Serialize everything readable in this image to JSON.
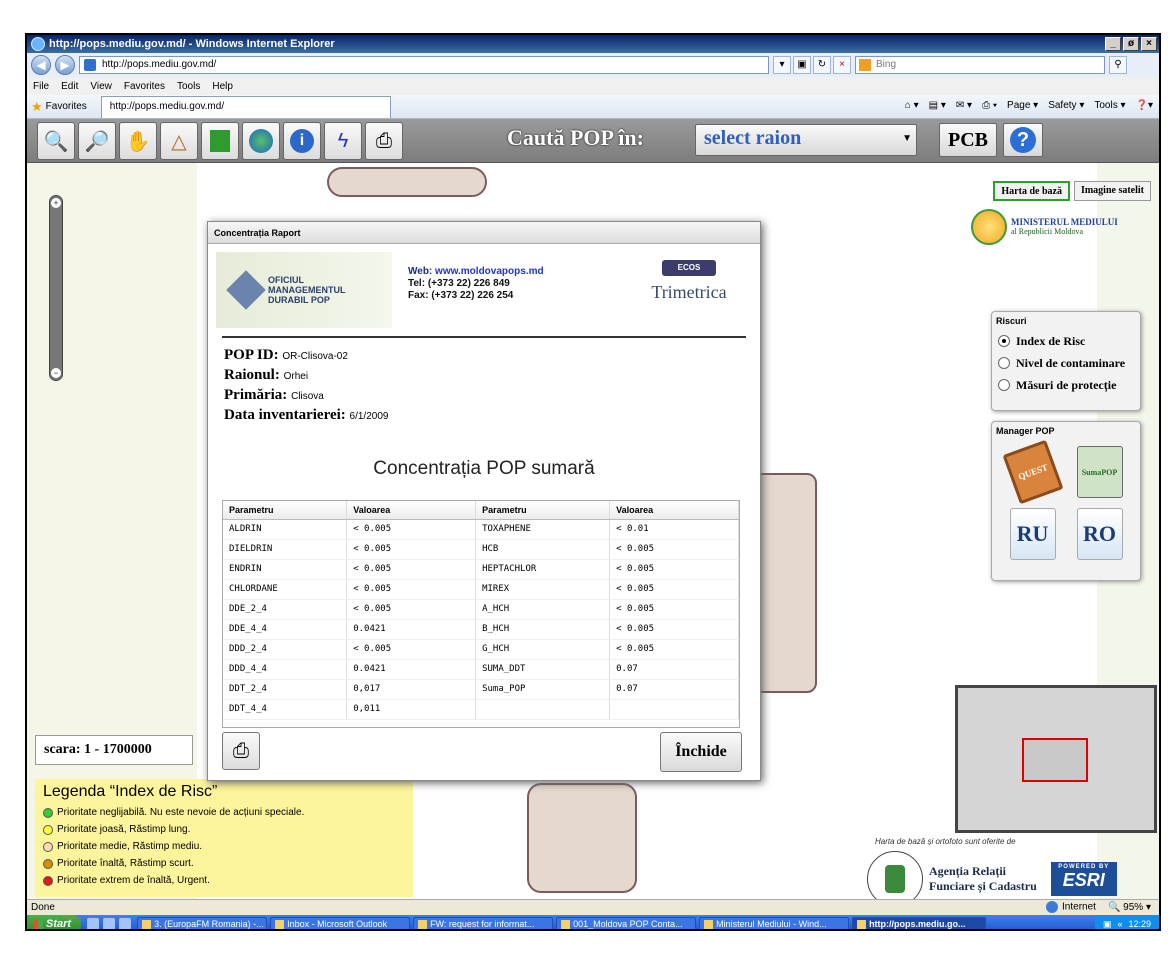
{
  "window": {
    "title": "http://pops.mediu.gov.md/ - Windows Internet Explorer",
    "address": "http://pops.mediu.gov.md/",
    "search_placeholder": "Bing",
    "controls": {
      "minimize": "_",
      "maximize": "ø",
      "close": "×"
    }
  },
  "menu": [
    "File",
    "Edit",
    "View",
    "Favorites",
    "Tools",
    "Help"
  ],
  "favbar": {
    "favorites_label": "Favorites",
    "tab_title": "http://pops.mediu.gov.md/",
    "commands": [
      "Page ▾",
      "Safety ▾",
      "Tools ▾"
    ]
  },
  "toolbar": {
    "search_label": "Caută POP în:",
    "raion_select": "select raion",
    "pcb_label": "PCB",
    "help_label": "?"
  },
  "map": {
    "scale_label": "scara: 1 - 1700000",
    "basemap_buttons": [
      "Harta de bază",
      "Imagine satelit"
    ],
    "ministry_name": "MINISTERUL MEDIULUI",
    "ministry_sub": "al Republicii Moldova",
    "credit": "Harta de bază și ortofoto sunt oferite de",
    "agency_line1": "Agenția Relații",
    "agency_line2": "Funciare și Cadastru",
    "esri_powered": "POWERED BY",
    "esri_logo": "ESRI"
  },
  "legend": {
    "title": "Legenda “Index de Risc”",
    "items": [
      {
        "color": "#33cc33",
        "label": "Prioritate neglijabilă. Nu este nevoie de acțiuni speciale."
      },
      {
        "color": "#ffff33",
        "label": "Prioritate joasă, Răstimp lung."
      },
      {
        "color": "#ffd9b3",
        "label": "Prioritate medie, Răstimp mediu."
      },
      {
        "color": "#d98c00",
        "label": "Prioritate înaltă, Răstimp scurt."
      },
      {
        "color": "#e31a1c",
        "label": "Prioritate extrem de înaltă, Urgent."
      }
    ]
  },
  "riscuri": {
    "title": "Riscuri",
    "options": [
      "Index de Risc",
      "Nivel de contaminare",
      "Măsuri de protecție"
    ],
    "selected": 0
  },
  "manager": {
    "title": "Manager POP",
    "quest": "QUEST",
    "suma": "SumaPOP",
    "ru": "RU",
    "ro": "RO"
  },
  "modal": {
    "title": "Concentrația Raport",
    "org": {
      "line1": "OFICIUL",
      "line2": "MANAGEMENTUL",
      "line3": "DURABIL POP"
    },
    "web_label": "Web:",
    "web": "www.moldovapops.md",
    "tel": "Tel:  (+373 22) 226 849",
    "fax": "Fax: (+373 22) 226 254",
    "ecos": "ECOS",
    "trimetrica": "Trimetrica",
    "pop_id_label": "POP ID:",
    "pop_id": "OR-Clisova-02",
    "raion_label": "Raionul:",
    "raion": "Orhei",
    "primaria_label": "Primăria:",
    "primaria": "Clisova",
    "data_label": "Data inventarierei:",
    "data": "6/1/2009",
    "summary_title": "Concentrația POP sumară",
    "headers": [
      "Parametru",
      "Valoarea",
      "Parametru",
      "Valoarea"
    ],
    "rows": [
      [
        "ALDRIN",
        "< 0.005",
        "TOXAPHENE",
        "< 0.01"
      ],
      [
        "DIELDRIN",
        "< 0.005",
        "HCB",
        "< 0.005"
      ],
      [
        "ENDRIN",
        "< 0.005",
        "HEPTACHLOR",
        "< 0.005"
      ],
      [
        "CHLORDANE",
        "< 0.005",
        "MIREX",
        "< 0.005"
      ],
      [
        "DDE_2_4",
        "< 0.005",
        "A_HCH",
        "< 0.005"
      ],
      [
        "DDE_4_4",
        "0.0421",
        "B_HCH",
        "< 0.005"
      ],
      [
        "DDD_2_4",
        "< 0.005",
        "G_HCH",
        "< 0.005"
      ],
      [
        "DDD_4_4",
        "0.0421",
        "SUMA_DDT",
        "0.07"
      ],
      [
        "DDT_2_4",
        "0,017",
        "Suma_POP",
        "0.07"
      ],
      [
        "DDT_4_4",
        "0,011",
        "",
        ""
      ]
    ],
    "close_label": "Închide"
  },
  "status": {
    "left": "Done",
    "zone": "Internet",
    "zoom": "95%"
  },
  "taskbar": {
    "start": "Start",
    "items": [
      "3. (EuropaFM Romania) -...",
      "Inbox - Microsoft Outlook",
      "FW: request for informat...",
      "001_Moldova POP Conta...",
      "Ministerul Mediului - Wind...",
      "http://pops.mediu.go..."
    ],
    "active_index": 5,
    "time": "12:29"
  }
}
